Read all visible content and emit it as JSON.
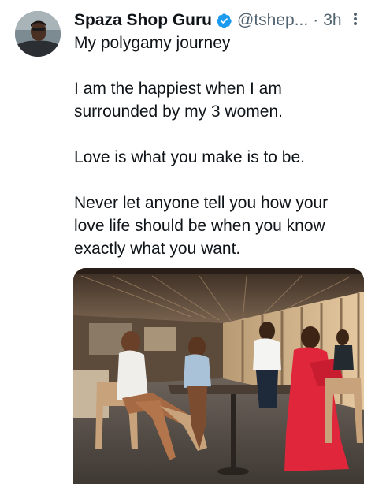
{
  "author": {
    "display_name": "Spaza Shop Guru",
    "handle": "@tshep...",
    "separator": "·",
    "time": "3h",
    "avatar_icon": "user-avatar",
    "verified_icon": "verified-badge-icon",
    "verified_color": "#1d9bf0"
  },
  "tweet": {
    "lines": [
      "My polygamy journey",
      "",
      "I am the happiest when I am",
      "surrounded by my 3 women.",
      "",
      "Love is what you make is to be.",
      "",
      "Never let anyone tell you how your",
      "love life should be when you know",
      "exactly what you want."
    ]
  },
  "actions": {
    "more_icon": "more-options-icon"
  },
  "colors": {
    "text": "#0f1419",
    "secondary": "#536471",
    "accent": "#1d9bf0"
  }
}
